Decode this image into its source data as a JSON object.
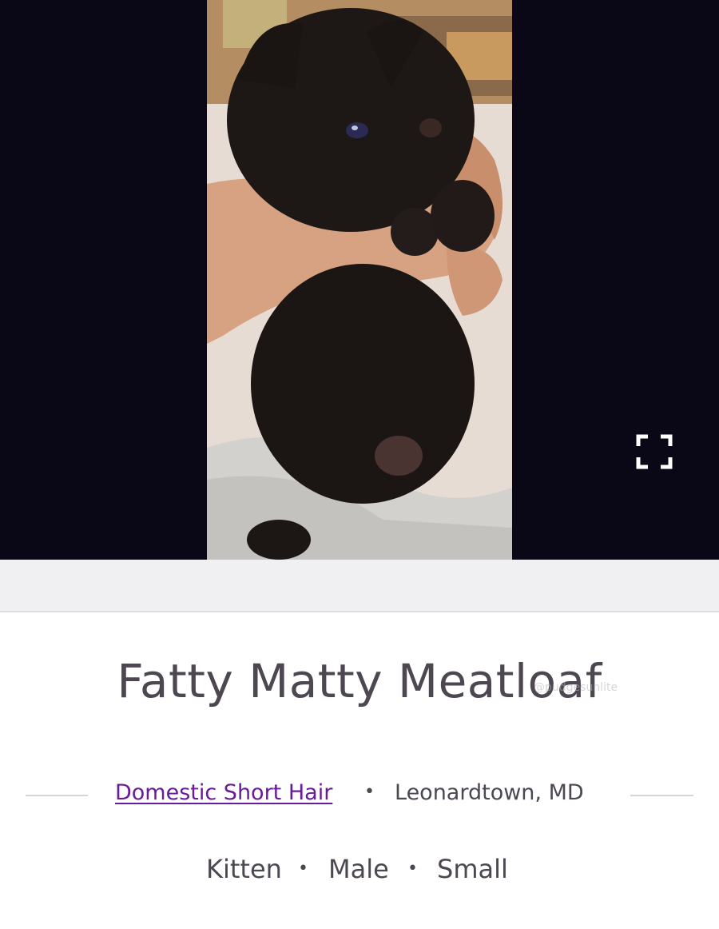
{
  "pet": {
    "name": "Fatty Matty Meatloaf",
    "watermark": "@pudgesunlite",
    "breed": "Domestic Short Hair",
    "location": "Leonardtown, MD",
    "separator": "•",
    "attributes": [
      "Kitten",
      "Male",
      "Small"
    ]
  },
  "media": {
    "photo_subject": "black-kitten-photo",
    "fullscreen_icon": "expand-fullscreen-icon"
  },
  "colors": {
    "hero_background": "#0a0816",
    "text": "#4d4751",
    "link": "#6a1b9a",
    "band": "#f0f0f2"
  }
}
